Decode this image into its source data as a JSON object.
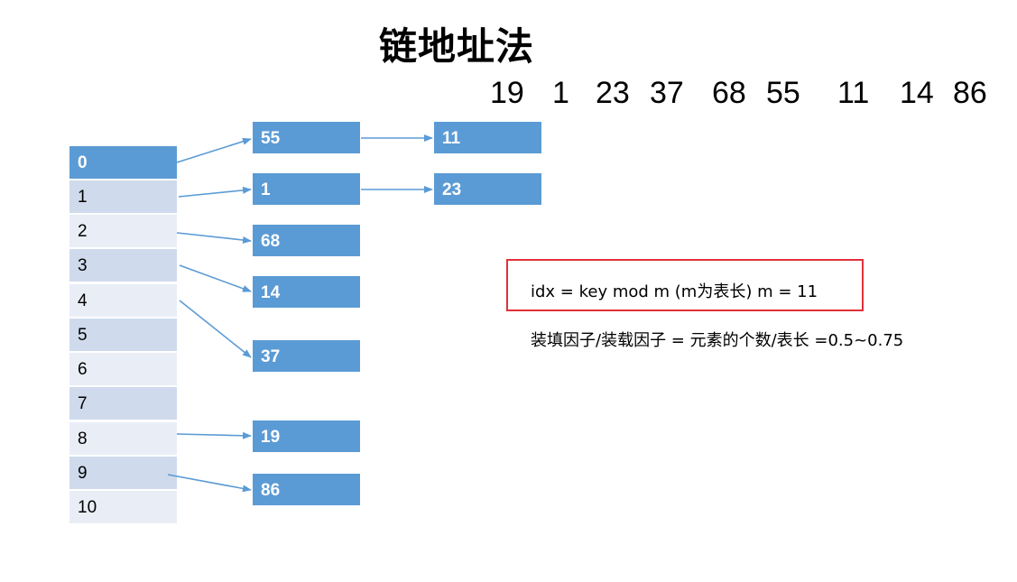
{
  "title": "链地址法",
  "keys": [
    "19",
    "1",
    "23",
    "37",
    "68",
    "55",
    "11",
    "14",
    "86"
  ],
  "table_rows": [
    "0",
    "1",
    "2",
    "3",
    "4",
    "5",
    "6",
    "7",
    "8",
    "9",
    "10"
  ],
  "nodes": {
    "n55": "55",
    "n11": "11",
    "n1": "1",
    "n23": "23",
    "n68": "68",
    "n14": "14",
    "n37": "37",
    "n19": "19",
    "n86": "86"
  },
  "formula": "idx = key mod m   (m为表长)  m = 11",
  "load_factor": "装填因子/装载因子 = 元素的个数/表长 =0.5~0.75",
  "colors": {
    "node_fill": "#5B9BD5",
    "row_dark": "#CFDAEC",
    "row_light": "#E9EEF6",
    "box_border": "#E0313A"
  }
}
